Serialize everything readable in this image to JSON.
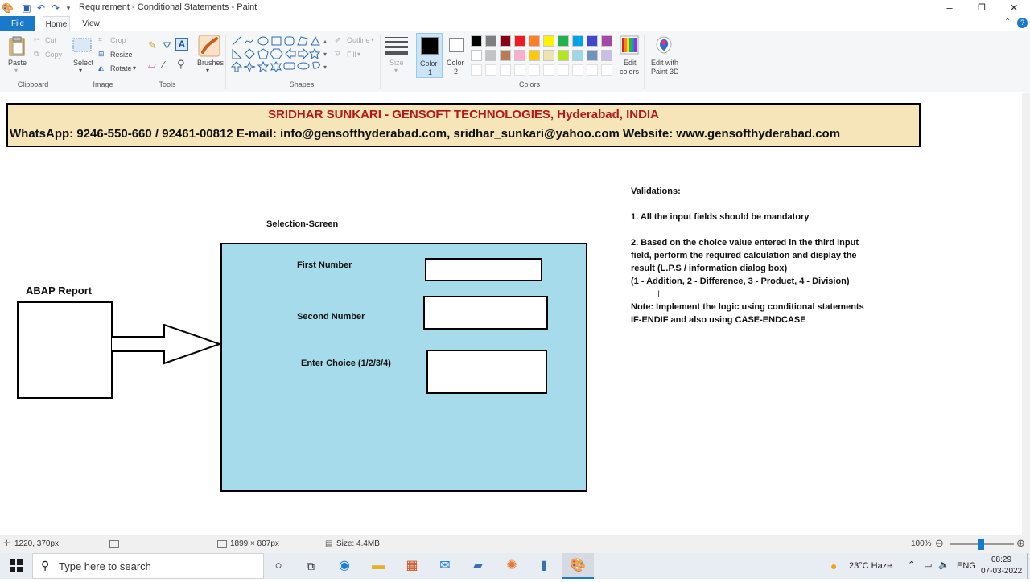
{
  "window": {
    "title": "Requirement - Conditional Statements - Paint"
  },
  "menu_tabs": [
    {
      "label": "File"
    },
    {
      "label": "Home"
    },
    {
      "label": "View"
    }
  ],
  "ribbon": {
    "clipboard": {
      "paste": "Paste",
      "cut": "Cut",
      "copy": "Copy",
      "group": "Clipboard"
    },
    "image": {
      "select": "Select",
      "crop": "Crop",
      "resize": "Resize",
      "rotate": "Rotate",
      "group": "Image"
    },
    "tools": {
      "group": "Tools"
    },
    "brushes": "Brushes",
    "shapes": {
      "outline": "Outline",
      "fill": "Fill",
      "group": "Shapes"
    },
    "size": "Size",
    "color1": {
      "label": "Color",
      "num": "1"
    },
    "color2": {
      "label": "Color",
      "num": "2"
    },
    "colors_group": "Colors",
    "edit_colors": {
      "l1": "Edit",
      "l2": "colors"
    },
    "paint3d": {
      "l1": "Edit with",
      "l2": "Paint 3D"
    },
    "palette_row1": [
      "#000000",
      "#7f7f7f",
      "#880015",
      "#ed1c24",
      "#ff7f27",
      "#fff200",
      "#22b14c",
      "#00a2e8",
      "#3f48cc",
      "#a349a4"
    ],
    "palette_row2": [
      "#ffffff",
      "#c3c3c3",
      "#b97a57",
      "#ffaec9",
      "#ffc90e",
      "#efe4b0",
      "#b5e61d",
      "#99d9ea",
      "#7092be",
      "#c8bfe7"
    ]
  },
  "canvas": {
    "banner": {
      "line1": "SRIDHAR SUNKARI - GENSOFT TECHNOLOGIES, Hyderabad, INDIA",
      "line2": "WhatsApp: 9246-550-660 / 92461-00812    E-mail: info@gensofthyderabad.com, sridhar_sunkari@yahoo.com    Website: www.gensofthyderabad.com"
    },
    "abap_report": "ABAP Report",
    "selection_screen": "Selection-Screen",
    "fields": {
      "first": "First Number",
      "second": "Second Number",
      "choice": "Enter Choice (1/2/3/4)"
    },
    "validations": [
      "Validations:",
      "1. All the input fields should be mandatory",
      "2. Based on the choice value entered in the third input",
      "field, perform the required calculation and display the",
      "result (L.P.S / information dialog box)",
      "(1 - Addition, 2 - Difference, 3 - Product, 4 - Division)",
      "Note: Implement the logic using conditional statements",
      "IF-ENDIF and also using CASE-ENDCASE"
    ]
  },
  "statusbar": {
    "cursor": "1220, 370px",
    "dimensions": "1899 × 807px",
    "size": "Size: 4.4MB",
    "zoom": "100%"
  },
  "taskbar": {
    "search_placeholder": "Type here to search",
    "weather": "23°C  Haze",
    "lang": "ENG",
    "time": "08:29",
    "date": "07-03-2022"
  },
  "colors": {
    "accent": "#1979ca",
    "banner_bg": "#f5e5b9",
    "banner_title": "#b5181a",
    "selection_bg": "#a5dbea"
  }
}
